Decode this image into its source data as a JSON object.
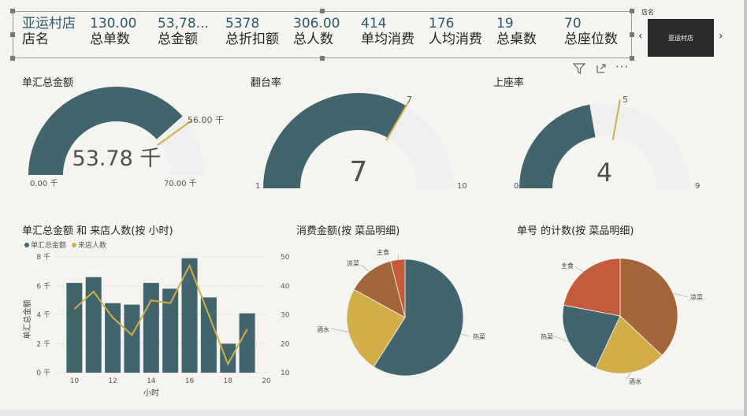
{
  "kpis": [
    {
      "value": "亚运村店",
      "label": "店名"
    },
    {
      "value": "130.00",
      "label": "总单数"
    },
    {
      "value": "53,78...",
      "label": "总金额"
    },
    {
      "value": "5378",
      "label": "总折扣额"
    },
    {
      "value": "306.00",
      "label": "总人数"
    },
    {
      "value": "414",
      "label": "单均消费"
    },
    {
      "value": "176",
      "label": "人均消费"
    },
    {
      "value": "19",
      "label": "总桌数"
    },
    {
      "value": "70",
      "label": "总座位数"
    }
  ],
  "slicer": {
    "title": "店名",
    "selected": "亚运村店"
  },
  "gauges": [
    {
      "title": "单汇总金额",
      "value": 53.78,
      "min": 0,
      "max": 70,
      "target": 56,
      "value_label": "53.78 千",
      "min_label": "0.00 千",
      "max_label": "70.00 千",
      "target_label": "56.00 千"
    },
    {
      "title": "翻台率",
      "value": 7,
      "min": 1,
      "max": 10,
      "target": 7,
      "value_label": "7",
      "min_label": "1",
      "max_label": "10",
      "target_label": "7"
    },
    {
      "title": "上座率",
      "value": 4,
      "min": 0,
      "max": 9,
      "target": 5,
      "value_label": "4",
      "min_label": "0",
      "max_label": "9",
      "target_label": "5"
    }
  ],
  "combo": {
    "title": "单汇总金额 和 来店人数(按 小时)",
    "legend": [
      "单汇总金额",
      "来店人数"
    ],
    "xlabel": "小时",
    "ylabel": "单汇总金额",
    "left_ticks": [
      "0 千",
      "2 千",
      "4 千",
      "6 千",
      "8 千"
    ],
    "right_ticks": [
      "10",
      "20",
      "30",
      "40",
      "50"
    ],
    "x_ticks": [
      "10",
      "12",
      "14",
      "16",
      "18",
      "20"
    ]
  },
  "pie1": {
    "title": "消费金额(按 菜品明细)",
    "labels": [
      "热菜",
      "酒水",
      "凉菜",
      "主食"
    ]
  },
  "pie2": {
    "title": "单号 的计数(按 菜品明细)",
    "labels": [
      "凉菜",
      "酒水",
      "热菜",
      "主食"
    ]
  },
  "colors": {
    "teal": "#41646d",
    "gold": "#d3ad48",
    "brown": "#a3663a",
    "red": "#c55a3c",
    "track": "#efefef",
    "target": "#d3ad48"
  },
  "chart_data": [
    {
      "type": "gauge",
      "title": "单汇总金额",
      "value": 53.78,
      "min": 0,
      "max": 70,
      "target": 56,
      "unit": "千"
    },
    {
      "type": "gauge",
      "title": "翻台率",
      "value": 7,
      "min": 1,
      "max": 10,
      "target": 7
    },
    {
      "type": "gauge",
      "title": "上座率",
      "value": 4,
      "min": 0,
      "max": 9,
      "target": 5
    },
    {
      "type": "bar",
      "title": "单汇总金额 和 来店人数(按 小时)",
      "x": [
        10,
        11,
        12,
        13,
        14,
        15,
        16,
        17,
        18,
        19
      ],
      "series": [
        {
          "name": "单汇总金额",
          "type": "bar",
          "axis": "left",
          "values": [
            6.2,
            6.6,
            4.8,
            4.7,
            6.2,
            5.8,
            7.9,
            5.2,
            2.0,
            4.1
          ]
        },
        {
          "name": "来店人数",
          "type": "line",
          "axis": "right",
          "values": [
            32,
            38,
            29,
            23,
            35,
            34,
            47,
            30,
            13,
            25
          ]
        }
      ],
      "xlabel": "小时",
      "ylabel": "单汇总金额",
      "ylim": [
        0,
        8
      ],
      "y2lim": [
        10,
        50
      ],
      "xlim": [
        9,
        20
      ]
    },
    {
      "type": "pie",
      "title": "消费金额(按 菜品明细)",
      "labels": [
        "热菜",
        "酒水",
        "凉菜",
        "主食"
      ],
      "values": [
        59,
        24,
        13,
        4
      ]
    },
    {
      "type": "pie",
      "title": "单号 的计数(按 菜品明细)",
      "labels": [
        "凉菜",
        "酒水",
        "热菜",
        "主食"
      ],
      "values": [
        37,
        20,
        21,
        22
      ]
    }
  ]
}
